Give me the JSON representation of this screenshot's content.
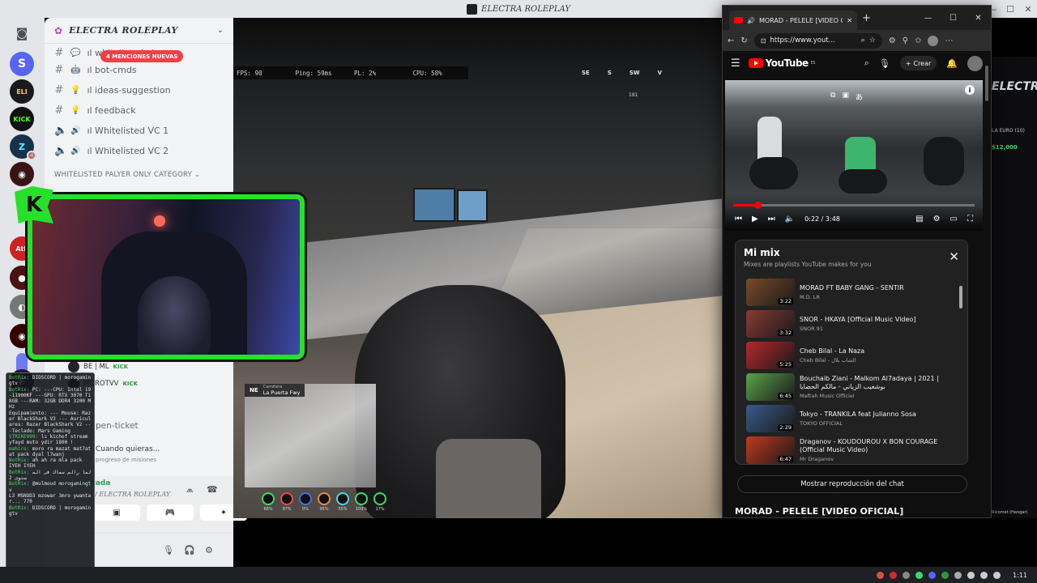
{
  "window": {
    "title": "ELECTRA ROLEPLAY"
  },
  "server": {
    "name": "ELECTRA ROLEPLAY",
    "mentions_badge": "4 MENCIONES NUEVAS",
    "channels": [
      {
        "emoji": "💬",
        "label": "ıl whitelisted-chat",
        "type": "text"
      },
      {
        "emoji": "🤖",
        "label": "ıl bot-cmds",
        "type": "text"
      },
      {
        "emoji": "💡",
        "label": "ıl ideas-suggestion",
        "type": "text"
      },
      {
        "emoji": "💡",
        "label": "ıl feedback",
        "type": "text"
      },
      {
        "emoji": "🔊",
        "label": "ıl Whitelisted VC 1",
        "type": "voice"
      },
      {
        "emoji": "🔊",
        "label": "ıl Whitelisted VC 2",
        "type": "voice"
      }
    ],
    "category": "WHITELISTED PALYER ONLY CATEGORY",
    "voice_users": [
      {
        "name": "BE | ML",
        "tag": "KICK"
      },
      {
        "name": "MOROTVV",
        "tag": "KICK"
      }
    ],
    "ticket_channel": "pen-ticket",
    "activity_title": "Cuando quieras...",
    "activity_sub": "progreso de misiones",
    "voice_connected": "Voz conectada",
    "voice_server": "/ ELECTRA ROLEPLAY"
  },
  "chat_overlay": [
    {
      "user": "BotRix:",
      "text": "DIDSCORD | morogamingtv"
    },
    {
      "user": "BotRix:",
      "text": "PC: ---CPU: Intel i9-11900KF ---GPU: RTX 3070 Ti 8GB ---RAM: 32GB DDR4 3200 MHz"
    },
    {
      "user": "",
      "text": "Equipamiento: --- Mouse: Razer BlackShark V3 --- Auriculares: Razer BlackShark V2 ---Teclado: Mars Gaming"
    },
    {
      "user": "STRIKE999:",
      "text": "lı kichof stream yfayd muto ydir 1800 !"
    },
    {
      "user": "mahiro:",
      "text": "moro ra mazat mat7atat pack dyal l7wanj"
    },
    {
      "user": "BotRix:",
      "text": "ah ah ra mla pack"
    },
    {
      "user": "",
      "text": "IYEH IYEH"
    },
    {
      "user": "BotRix:",
      "text": "لما رالم سماك فى المستوى 2"
    },
    {
      "user": "BotRix:",
      "text": "@mulmoud morogamingtv"
    },
    {
      "user": "",
      "text": "L3 MSNOD3 mzowar 3mro ywantar... 770"
    },
    {
      "user": "BotRix:",
      "text": "DIDSCORD | morogamingtv"
    }
  ],
  "game": {
    "fps": "FPS: 90",
    "ping": "Ping: 59ms",
    "pl": "PL: 2%",
    "cpu": "CPU: 58%",
    "compass": [
      "SE",
      "S",
      "SW",
      "V"
    ],
    "compass_value": "181",
    "location_dir": "NE",
    "location_street": "La Puerta Fwy",
    "location_small": "Carretera",
    "stats": [
      "66%",
      "97%",
      "0%",
      "95%",
      "55%",
      "100%",
      "17%"
    ],
    "right_title": "ELECTRA",
    "right_line1": "LA EURO (10)",
    "right_money": "$12,000",
    "right_bottom": "Ricomet (Hangar)"
  },
  "browser": {
    "tab_title": "MORAD - PELELE [VIDEO OFICIAL]",
    "url": "https://www.yout...",
    "yt_region": "ES",
    "create_label": "Crear",
    "player": {
      "time": "0:22 / 3:48",
      "progress": 0.1
    },
    "mix_title": "Mi mix",
    "mix_sub": "Mixes are playlists YouTube makes for you",
    "mix_items": [
      {
        "title": "MORAD FT BABY GANG - SENTIR",
        "channel": "M.D. LR",
        "duration": "3:22",
        "color": "#7a4a2a"
      },
      {
        "title": "SNOR - HKAYA [Official Music Video]",
        "channel": "SNOR 91",
        "duration": "3:32",
        "color": "#8a3a36"
      },
      {
        "title": "Cheb Bilal - La Naza",
        "channel": "Cheb Bilal - الشاب بلال",
        "duration": "5:25",
        "color": "#b6282c"
      },
      {
        "title": "Bouchaib Ziani - Malkom Al7adaya | 2021 | بوشعيب الزياني - مالكم الحضايا",
        "channel": "Meftah Music Officiel",
        "duration": "6:45",
        "color": "#5aa24a"
      },
      {
        "title": "Tokyo - TRANKILA feat Julianno Sosa",
        "channel": "TOKYO OFFICIAL",
        "duration": "2:29",
        "color": "#3a5a8a"
      },
      {
        "title": "Draganov - KOUDOUROU X BON COURAGE (Official Music Video)",
        "channel": "Mr Draganov",
        "duration": "6:47",
        "color": "#c0391e"
      }
    ],
    "chat_replay_label": "Mostrar reproducción del chat",
    "video_title": "MORAD - PELELE [VIDEO OFICIAL]"
  },
  "taskbar": {
    "clock": "1:11"
  }
}
